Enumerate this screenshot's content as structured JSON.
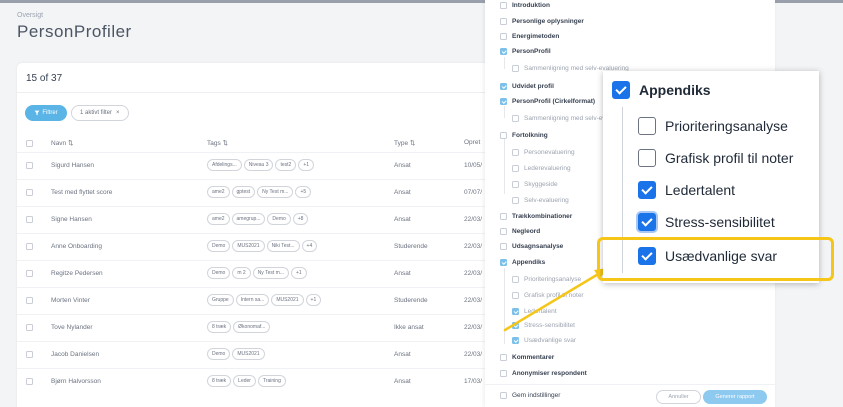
{
  "header": {
    "breadcrumb": "Oversigt",
    "title": "PersonProfiler"
  },
  "list": {
    "count": "15 of 37",
    "filter_button": "Filtrer",
    "active_filter": "1 aktivt filter",
    "columns": {
      "name": "Navn",
      "tags": "Tags",
      "type": "Type",
      "created": "Opret"
    },
    "rows": [
      {
        "name": "Sigurd Hansen",
        "tags": [
          "Afdelings...",
          "Niveau 3",
          "test2"
        ],
        "more": "+1",
        "type": "Ansat",
        "date": "10/05/"
      },
      {
        "name": "Test med flyttet score",
        "tags": [
          "ame2",
          "gptest",
          "Ny Test m..."
        ],
        "more": "+5",
        "type": "Ansat",
        "date": "07/07/"
      },
      {
        "name": "Signe Hansen",
        "tags": [
          "ame2",
          "amegrup...",
          "Demo"
        ],
        "more": "+8",
        "type": "Ansat",
        "date": "22/03/"
      },
      {
        "name": "Anne Onboarding",
        "tags": [
          "Demo",
          "MUS2021",
          "Niki Test..."
        ],
        "more": "+4",
        "type": "Studerende",
        "date": "22/03/"
      },
      {
        "name": "Regitze Pedersen",
        "tags": [
          "Demo",
          "m 2",
          "Ny Test m..."
        ],
        "more": "+1",
        "type": "Ansat",
        "date": "22/03/"
      },
      {
        "name": "Morten Vinter",
        "tags": [
          "Gruppe",
          "Intern sa...",
          "MUS2021"
        ],
        "more": "+1",
        "type": "Studerende",
        "date": "22/03/"
      },
      {
        "name": "Tove Nylander",
        "tags": [
          "8 træk",
          "Økonomaf..."
        ],
        "more": "",
        "type": "Ikke ansat",
        "date": "22/03/"
      },
      {
        "name": "Jacob Danielsen",
        "tags": [
          "Demo",
          "MUS2021"
        ],
        "more": "",
        "type": "Ansat",
        "date": "22/03/"
      },
      {
        "name": "Bjørn Halvorsson",
        "tags": [
          "8 træk",
          "Leder",
          "Training"
        ],
        "more": "",
        "type": "Ansat",
        "date": "17/03/"
      }
    ]
  },
  "panel": {
    "items": [
      {
        "label": "Introduktion",
        "checked": false,
        "level": 0
      },
      {
        "label": "Personlige oplysninger",
        "checked": false,
        "level": 0
      },
      {
        "label": "Energimetoden",
        "checked": false,
        "level": 0
      },
      {
        "label": "PersonProfil",
        "checked": true,
        "level": 0
      },
      {
        "label": "Sammenligning med selv-evaluering",
        "checked": false,
        "level": 1
      },
      {
        "label": "Udvidet profil",
        "checked": true,
        "level": 0
      },
      {
        "label": "PersonProfil (Cirkelformat)",
        "checked": true,
        "level": 0
      },
      {
        "label": "Sammenligning med selv-ev...",
        "checked": false,
        "level": 1
      },
      {
        "label": "Fortolkning",
        "checked": false,
        "level": 0
      },
      {
        "label": "Personevaluering",
        "checked": false,
        "level": 1
      },
      {
        "label": "Lederevaluering",
        "checked": false,
        "level": 1
      },
      {
        "label": "Skyggeside",
        "checked": false,
        "level": 1
      },
      {
        "label": "Selv-evaluering",
        "checked": false,
        "level": 1
      },
      {
        "label": "Trækkombinationer",
        "checked": false,
        "level": 0
      },
      {
        "label": "Negleord",
        "checked": false,
        "level": 0
      },
      {
        "label": "Udsagnsanalyse",
        "checked": false,
        "level": 0
      },
      {
        "label": "Appendiks",
        "checked": true,
        "level": 0
      },
      {
        "label": "Prioriteringsanalyse",
        "checked": false,
        "level": 1
      },
      {
        "label": "Grafisk profil til noter",
        "checked": false,
        "level": 1
      },
      {
        "label": "Ledertalent",
        "checked": true,
        "level": 1
      },
      {
        "label": "Stress-sensibilitet",
        "checked": true,
        "level": 1
      },
      {
        "label": "Usædvanlige svar",
        "checked": true,
        "level": 1
      },
      {
        "label": "Kommentarer",
        "checked": false,
        "level": 0
      },
      {
        "label": "Anonymiser respondent",
        "checked": false,
        "level": 0
      }
    ],
    "save_settings": "Gem indstillinger",
    "cancel": "Annuller",
    "generate": "Generer rapport"
  },
  "zoom": {
    "title": "Appendiks",
    "items": [
      {
        "label": "Prioriteringsanalyse",
        "checked": false
      },
      {
        "label": "Grafisk profil til noter",
        "checked": false
      },
      {
        "label": "Ledertalent",
        "checked": true
      },
      {
        "label": "Stress-sensibilitet",
        "checked": true
      },
      {
        "label": "Usædvanlige svar",
        "checked": true
      }
    ]
  },
  "colors": {
    "accent": "#5ab4e6",
    "checkbox_blue": "#1a73e8",
    "highlight": "#f5c518"
  }
}
